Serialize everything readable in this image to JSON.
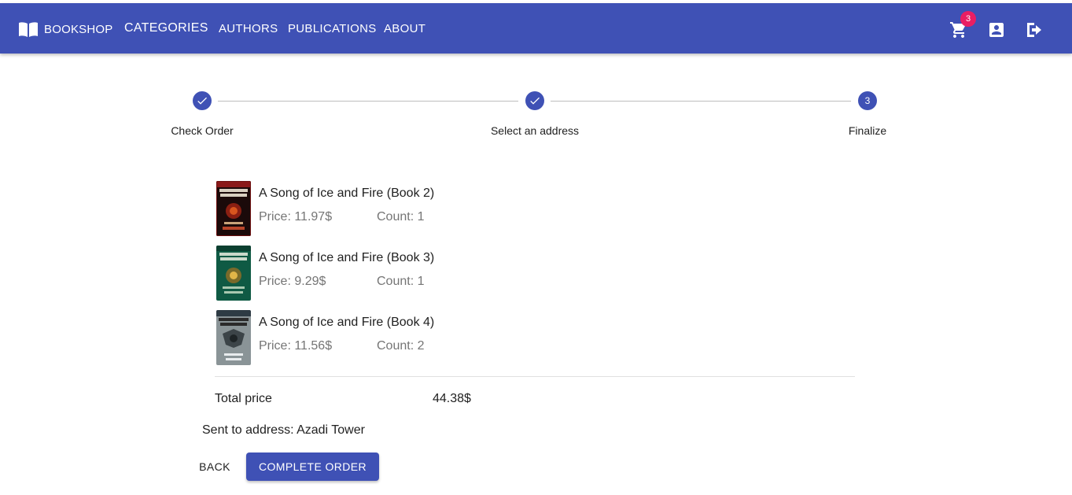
{
  "header": {
    "brand_label": "BOOKSHOP",
    "brand_icon": "book-open-icon",
    "nav": [
      "CATEGORIES",
      "AUTHORS",
      "PUBLICATIONS",
      "ABOUT"
    ],
    "cart_icon": "cart-icon",
    "cart_count": "3",
    "account_icon": "account-box-icon",
    "logout_icon": "logout-icon",
    "color": "#3f51b5",
    "badge_color": "#e91e63"
  },
  "stepper": {
    "steps": [
      {
        "label": "Check Order",
        "state": "completed",
        "icon": "check-icon"
      },
      {
        "label": "Select an address",
        "state": "completed",
        "icon": "check-icon"
      },
      {
        "label": "Finalize",
        "state": "active",
        "number": "3"
      }
    ]
  },
  "order": {
    "items": [
      {
        "title": "A Song of Ice and Fire (Book 2)",
        "price": "Price: 11.97$",
        "count": "Count: 1",
        "cover": "book-cover-red"
      },
      {
        "title": "A Song of Ice and Fire (Book 3)",
        "price": "Price: 9.29$",
        "count": "Count: 1",
        "cover": "book-cover-green"
      },
      {
        "title": "A Song of Ice and Fire (Book 4)",
        "price": "Price: 11.56$",
        "count": "Count: 2",
        "cover": "book-cover-grey"
      }
    ],
    "total_label": "Total price",
    "total_value": "44.38$",
    "address_text": "Sent to address: Azadi Tower"
  },
  "actions": {
    "back_label": "BACK",
    "complete_label": "COMPLETE ORDER"
  }
}
